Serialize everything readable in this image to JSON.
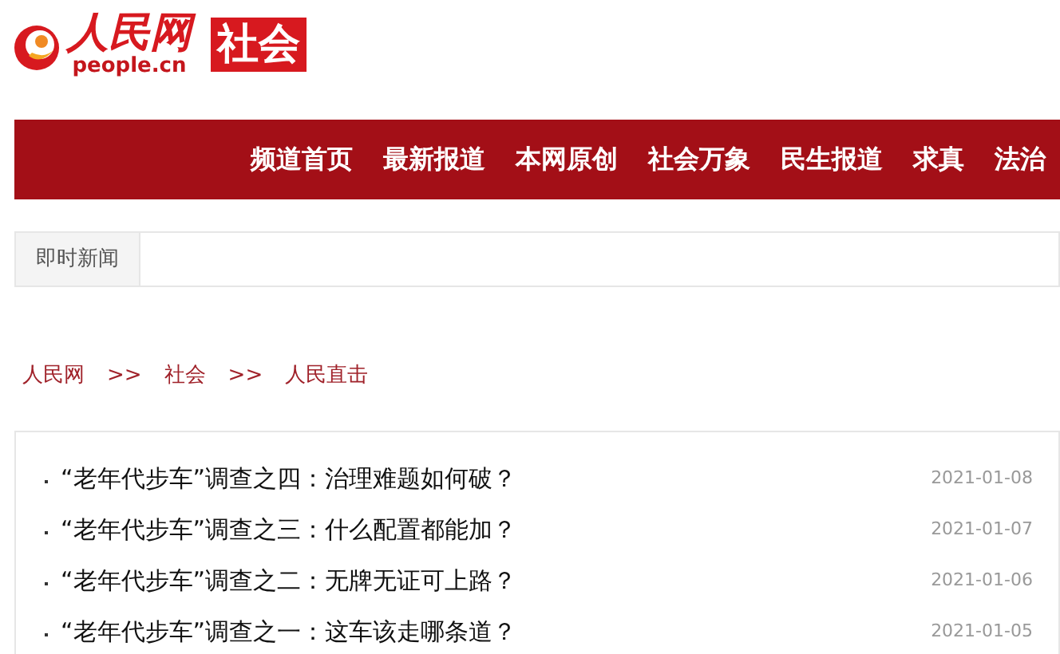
{
  "header": {
    "logo_title": "人民网",
    "logo_domain": "people.cn",
    "channel": "社会"
  },
  "nav": {
    "items": [
      {
        "label": "频道首页"
      },
      {
        "label": "最新报道"
      },
      {
        "label": "本网原创"
      },
      {
        "label": "社会万象"
      },
      {
        "label": "民生报道"
      },
      {
        "label": "求真"
      },
      {
        "label": "法治"
      }
    ]
  },
  "tabs": [
    {
      "label": "即时新闻",
      "selected": true
    }
  ],
  "breadcrumb": [
    "人民网",
    "社会",
    "人民直击"
  ],
  "breadcrumb_separator": ">>",
  "news": [
    {
      "title": "“老年代步车”调查之四：治理难题如何破？",
      "date": "2021-01-08"
    },
    {
      "title": "“老年代步车”调查之三：什么配置都能加？",
      "date": "2021-01-07"
    },
    {
      "title": "“老年代步车”调查之二：无牌无证可上路？",
      "date": "2021-01-06"
    },
    {
      "title": "“老年代步车”调查之一：这车该走哪条道？",
      "date": "2021-01-05"
    }
  ]
}
